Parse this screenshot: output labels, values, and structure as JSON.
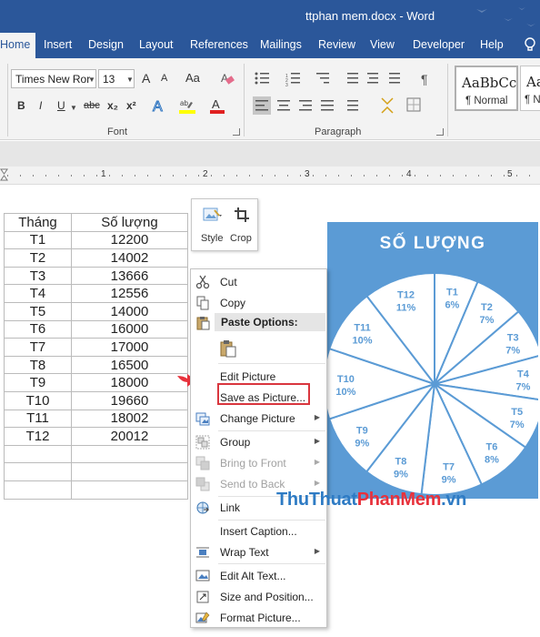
{
  "window": {
    "title": "ttphan mem.docx  -  Word"
  },
  "tabs": [
    {
      "label": "Home",
      "active": true
    },
    {
      "label": "Insert"
    },
    {
      "label": "Design"
    },
    {
      "label": "Layout"
    },
    {
      "label": "References"
    },
    {
      "label": "Mailings"
    },
    {
      "label": "Review"
    },
    {
      "label": "View"
    },
    {
      "label": "Developer"
    },
    {
      "label": "Help"
    }
  ],
  "ribbon": {
    "font_name": "Times New Ror",
    "font_size": "13",
    "aa_large": "A",
    "aa_small": "A",
    "change_case": "Aa",
    "bold": "B",
    "italic": "I",
    "underline": "U",
    "strike": "abc",
    "subscript": "x₂",
    "superscript": "x²",
    "font_group_label": "Font",
    "paragraph_group_label": "Paragraph",
    "styles": [
      {
        "sample": "AaBbCc",
        "name": "¶ Normal"
      },
      {
        "sample": "AaI",
        "name": "¶ N"
      }
    ]
  },
  "ruler": {
    "numbers": [
      "1",
      "2",
      "3",
      "4",
      "5"
    ]
  },
  "table": {
    "headers": [
      "Tháng",
      "Số lượng"
    ],
    "rows": [
      [
        "T1",
        "12200"
      ],
      [
        "T2",
        "14002"
      ],
      [
        "T3",
        "13666"
      ],
      [
        "T4",
        "12556"
      ],
      [
        "T5",
        "14000"
      ],
      [
        "T6",
        "16000"
      ],
      [
        "T7",
        "17000"
      ],
      [
        "T8",
        "16500"
      ],
      [
        "T9",
        "18000"
      ],
      [
        "T10",
        "19660"
      ],
      [
        "T11",
        "18002"
      ],
      [
        "T12",
        "20012"
      ],
      [
        "",
        ""
      ],
      [
        "",
        ""
      ],
      [
        "",
        ""
      ]
    ]
  },
  "chart_data": {
    "type": "pie",
    "title": "SỐ LƯỢNG",
    "categories": [
      "T1",
      "T2",
      "T3",
      "T4",
      "T5",
      "T6",
      "T7",
      "T8",
      "T9",
      "T10",
      "T11",
      "T12"
    ],
    "values": [
      12200,
      14002,
      13666,
      12556,
      14000,
      16000,
      17000,
      16500,
      18000,
      19660,
      18002,
      20012
    ],
    "labels_percent": [
      "6%",
      "7%",
      "7%",
      "7%",
      "7%",
      "8%",
      "9%",
      "9%",
      "9%",
      "10%",
      "10%",
      "11%"
    ],
    "background_color": "#5b9bd5",
    "slice_color": "#ffffff",
    "label_color": "#5b9bd5"
  },
  "minibar": {
    "style_label": "Style",
    "crop_label": "Crop"
  },
  "context_menu": {
    "paste_options_header": "Paste Options:",
    "items": [
      {
        "label": "Cut",
        "icon": "scissors-icon"
      },
      {
        "label": "Copy",
        "icon": "copy-icon"
      },
      {
        "label": "Edit Picture",
        "icon": ""
      },
      {
        "label": "Save as Picture...",
        "icon": ""
      },
      {
        "label": "Change Picture",
        "icon": "change-picture-icon"
      },
      {
        "label": "Group",
        "icon": "group-icon"
      },
      {
        "label": "Bring to Front",
        "icon": "bring-front-icon"
      },
      {
        "label": "Send to Back",
        "icon": "send-back-icon"
      },
      {
        "label": "Link",
        "icon": "link-icon"
      },
      {
        "label": "Insert Caption...",
        "icon": ""
      },
      {
        "label": "Wrap Text",
        "icon": "wrap-text-icon"
      },
      {
        "label": "Edit Alt Text...",
        "icon": "alt-text-icon"
      },
      {
        "label": "Size and Position...",
        "icon": "size-position-icon"
      },
      {
        "label": "Format Picture...",
        "icon": "format-picture-icon"
      }
    ]
  },
  "watermark": {
    "part1": "ThuThuat",
    "part2": "PhanMem",
    "part3": ".vn"
  },
  "colors": {
    "accent": "#2b579a",
    "highlight_border": "#d9363e",
    "arrow": "#e8323c"
  }
}
